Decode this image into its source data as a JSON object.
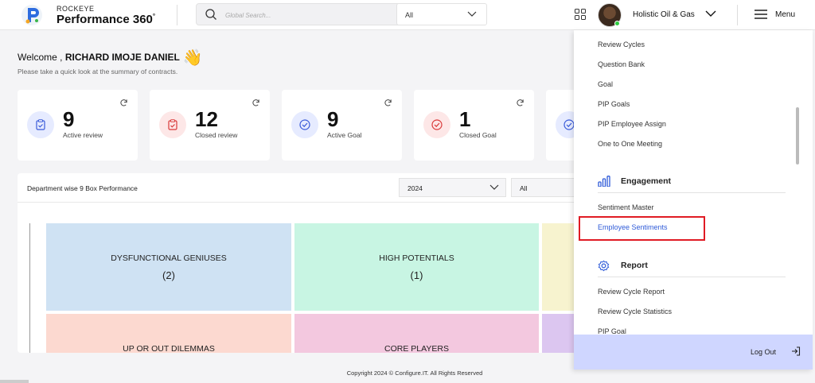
{
  "brand": {
    "small": "ROCKEYE",
    "name": "Performance 360",
    "mark": "°"
  },
  "search": {
    "placeholder": "Global Search...",
    "scope": "All"
  },
  "header": {
    "company": "Holistic Oil & Gas",
    "menu_label": "Menu"
  },
  "welcome": {
    "prefix": "Welcome ,",
    "name": "RICHARD IMOJE DANIEL",
    "wave": "👋",
    "subtitle": "Please take a quick look at the summary of contracts."
  },
  "cards": [
    {
      "value": "9",
      "label": "Active review",
      "color": "#e6ebff"
    },
    {
      "value": "12",
      "label": "Closed review",
      "color": "#fde7e7"
    },
    {
      "value": "9",
      "label": "Active Goal",
      "color": "#e6ebff"
    },
    {
      "value": "1",
      "label": "Closed Goal",
      "color": "#fde7e7"
    }
  ],
  "panel": {
    "title": "Department wise 9 Box Performance",
    "year": "2024",
    "filter": "All",
    "boxes": [
      {
        "title": "DYSFUNCTIONAL GENIUSES",
        "count": "(2)",
        "color": "#cfe2f3"
      },
      {
        "title": "HIGH POTENTIALS",
        "count": "(1)",
        "color": "#c8f5e3"
      },
      {
        "title": "UP OR OUT DILEMMAS",
        "count": "",
        "color": "#fcd9d0"
      },
      {
        "title": "CORE PLAYERS",
        "count": "",
        "color": "#f3c8df"
      }
    ]
  },
  "menu": {
    "items_top": [
      "Review Cycles",
      "Question Bank",
      "Goal",
      "PIP Goals",
      "PIP Employee Assign",
      "One to One Meeting"
    ],
    "engagement_title": "Engagement",
    "engagement_items": [
      "Sentiment Master",
      "Employee Sentiments"
    ],
    "report_title": "Report",
    "report_items": [
      "Review Cycle Report",
      "Review Cycle Statistics",
      "PIP Goal"
    ],
    "logout": "Log Out"
  },
  "footer": "Copyright 2024 © Configure.IT. All Rights Reserved"
}
